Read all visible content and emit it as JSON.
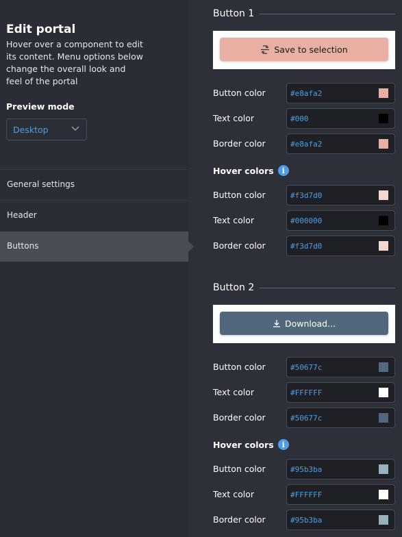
{
  "sidebar": {
    "title": "Edit portal",
    "description": "Hover over a component to edit its content. Menu options below change the overall look and feel of the portal",
    "preview_mode_label": "Preview mode",
    "preview_mode_value": "Desktop",
    "nav": [
      {
        "label": "General settings"
      },
      {
        "label": "Header"
      },
      {
        "label": "Buttons",
        "active": true
      }
    ]
  },
  "button1": {
    "title": "Button 1",
    "preview_label": "Save to selection",
    "preview_icon": "save-selection-icon",
    "colors": [
      {
        "label": "Button color",
        "value": "#e8afa2",
        "swatch": "#e8afa2"
      },
      {
        "label": "Text color",
        "value": "#000",
        "swatch": "#000000"
      },
      {
        "label": "Border color",
        "value": "#e8afa2",
        "swatch": "#e8afa2"
      }
    ],
    "hover_title": "Hover colors",
    "hover_colors": [
      {
        "label": "Button color",
        "value": "#f3d7d0",
        "swatch": "#f3d7d0"
      },
      {
        "label": "Text color",
        "value": "#000000",
        "swatch": "#000000"
      },
      {
        "label": "Border color",
        "value": "#f3d7d0",
        "swatch": "#f3d7d0"
      }
    ]
  },
  "button2": {
    "title": "Button 2",
    "preview_label": "Download...",
    "preview_icon": "download-icon",
    "colors": [
      {
        "label": "Button color",
        "value": "#50677c",
        "swatch": "#50677c"
      },
      {
        "label": "Text color",
        "value": "#FFFFFF",
        "swatch": "#FFFFFF"
      },
      {
        "label": "Border color",
        "value": "#50677c",
        "swatch": "#50677c"
      }
    ],
    "hover_title": "Hover colors",
    "hover_colors": [
      {
        "label": "Button color",
        "value": "#95b3ba",
        "swatch": "#95b3ba"
      },
      {
        "label": "Text color",
        "value": "#FFFFFF",
        "swatch": "#FFFFFF"
      },
      {
        "label": "Border color",
        "value": "#95b3ba",
        "swatch": "#95b3ba"
      }
    ]
  },
  "info_glyph": "i"
}
